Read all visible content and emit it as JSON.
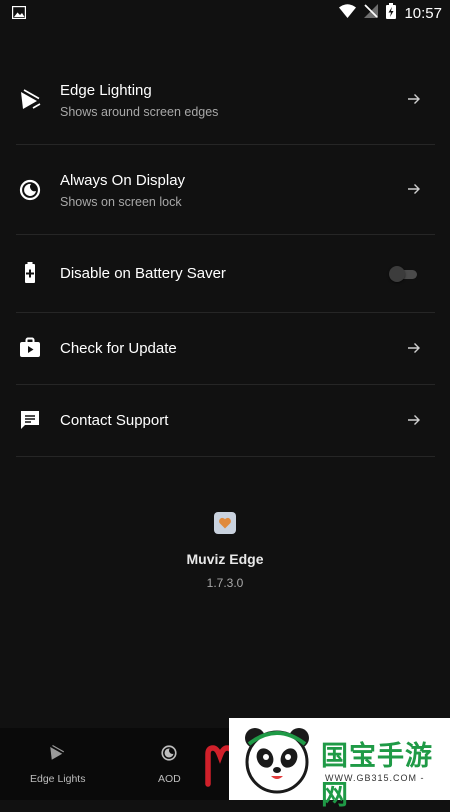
{
  "status_bar": {
    "time": "10:57",
    "left_icon": "image-notification-icon",
    "right_icons": [
      "wifi-icon",
      "no-signal-icon",
      "battery-charging-icon"
    ]
  },
  "settings": {
    "items": [
      {
        "icon": "edge-lighting-icon",
        "title": "Edge Lighting",
        "subtitle": "Shows around screen edges",
        "trailing": "arrow"
      },
      {
        "icon": "always-on-display-icon",
        "title": "Always On Display",
        "subtitle": "Shows on screen lock",
        "trailing": "arrow"
      },
      {
        "icon": "battery-icon",
        "title": "Disable on Battery Saver",
        "trailing": "toggle",
        "toggle_on": false
      },
      {
        "icon": "update-store-icon",
        "title": "Check for Update",
        "trailing": "arrow"
      },
      {
        "icon": "chat-icon",
        "title": "Contact Support",
        "trailing": "arrow"
      }
    ]
  },
  "about": {
    "app_name": "Muviz Edge",
    "version": "1.7.3.0",
    "icon_color": "#c9d2de",
    "heart_color": "#e08a3c"
  },
  "bottom_nav": {
    "items": [
      {
        "icon": "edge-lights-icon",
        "label": "Edge Lights"
      },
      {
        "icon": "aod-icon",
        "label": "AOD"
      },
      {
        "icon": "muviz-logo-icon",
        "label": ""
      }
    ]
  },
  "watermark": {
    "text": "国宝手游网",
    "url": "WWW.GB315.COM -"
  },
  "colors": {
    "background": "#111111",
    "divider": "#262626",
    "primary_text": "#ffffff",
    "secondary_text": "#a8a8a8",
    "watermark_green": "#1f9a46",
    "muviz_red": "#d0202a"
  }
}
